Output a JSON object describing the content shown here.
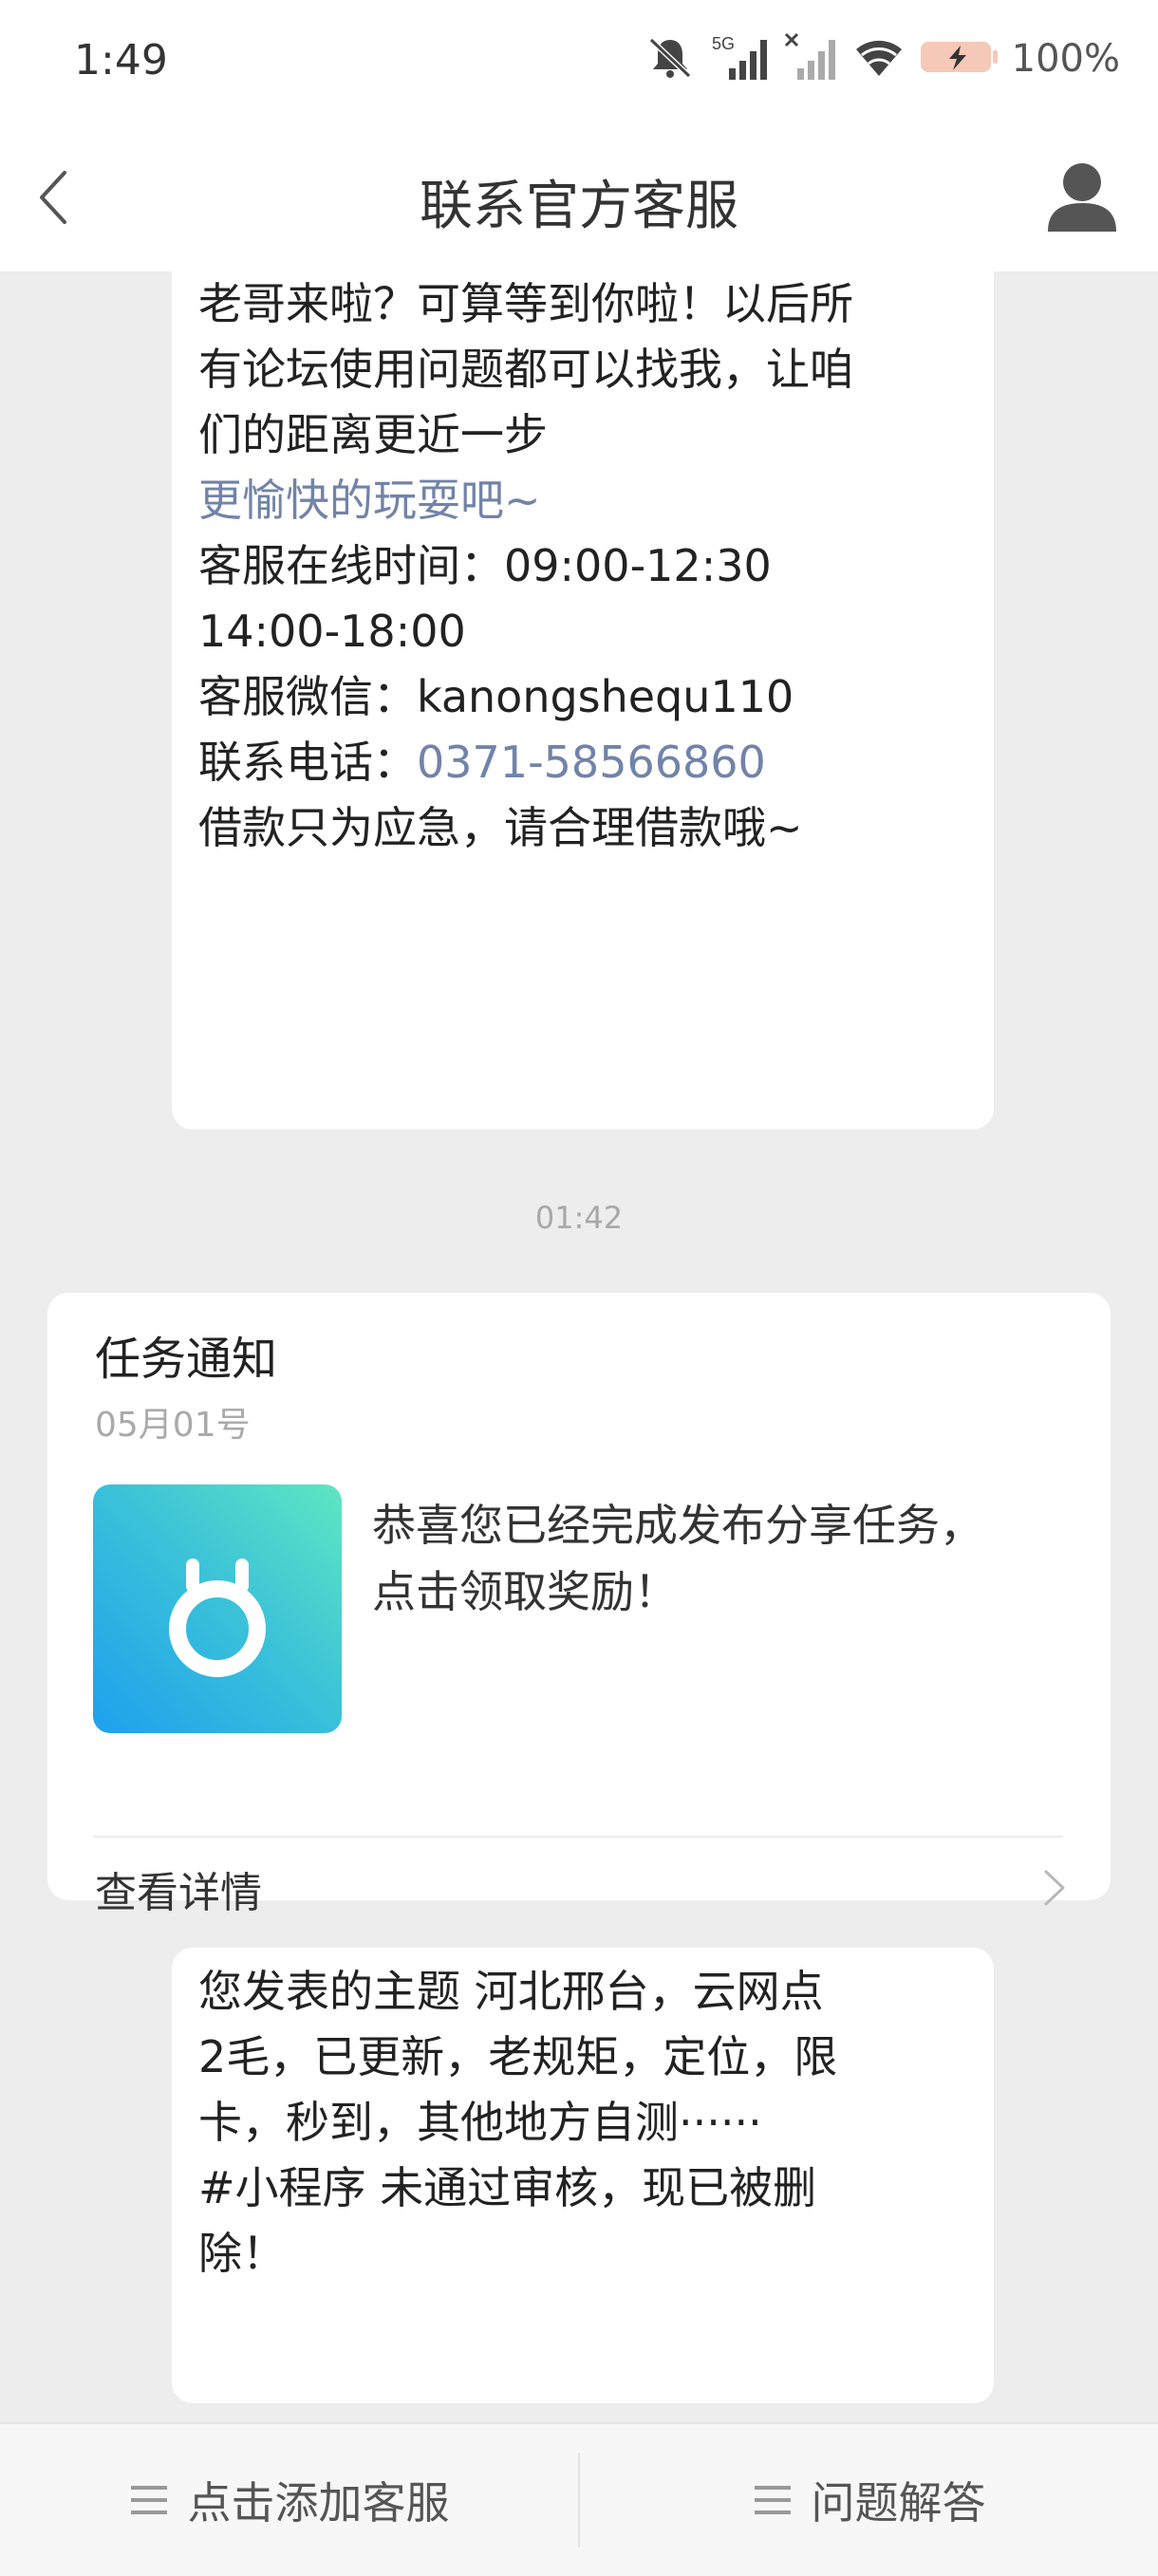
{
  "status_bar": {
    "time": "1:49",
    "network": "5G",
    "battery": "100%",
    "icons": [
      "mute-icon",
      "signal-5g-icon",
      "signal-no-service-icon",
      "wifi-icon",
      "battery-charging-icon"
    ]
  },
  "header": {
    "title": "联系官方客服",
    "back_icon": "chevron-left-icon",
    "user_icon": "user-profile-icon"
  },
  "messages": {
    "welcome": {
      "lines": [
        "老哥来啦？可算等到你啦！以后所",
        "有论坛使用问题都可以找我，让咱",
        "们的距离更近一步"
      ],
      "link": "更愉快的玩耍吧~",
      "hours_label": "客服在线时间：09:00-12:30",
      "hours_cont": "14:00-18:00",
      "wechat": "客服微信：kanongshequ110",
      "phone_label": "联系电话：",
      "phone": "0371-58566860",
      "footer": "借款只为应急，请合理借款哦~"
    },
    "timestamp": "01:42",
    "task_card": {
      "title": "任务通知",
      "date": "05月01号",
      "image_icon": "medal-icon",
      "text_line1": "恭喜您已经完成发布分享任务，",
      "text_line2": "点击领取奖励！",
      "detail": "查看详情",
      "chevron_icon": "chevron-right-icon"
    },
    "notice": {
      "lines": [
        "您发表的主题 河北邢台，云网点",
        "2毛，已更新，老规矩，定位，限",
        "卡，秒到，其他地方自测······"
      ],
      "lines2": [
        "#小程序 未通过审核，现已被删",
        "除！"
      ]
    }
  },
  "bottom_bar": {
    "left_label": "点击添加客服",
    "right_label": "问题解答",
    "menu_icon": "menu-icon"
  },
  "colors": {
    "link": "#7183a8",
    "background": "#ededed",
    "card_gradient_start": "#1ea0ee",
    "card_gradient_end": "#5ee6c2"
  }
}
